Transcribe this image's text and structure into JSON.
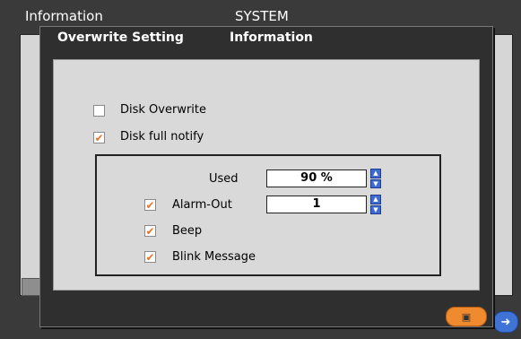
{
  "background_window": {
    "title": "Information",
    "center_title": "SYSTEM",
    "nav_icon": "arrow-right-icon"
  },
  "dialog": {
    "title": "Overwrite Setting",
    "tab": "Information",
    "disk_overwrite": {
      "label": "Disk Overwrite",
      "checked": false
    },
    "disk_full_notify": {
      "label": "Disk full notify",
      "checked": true
    },
    "used": {
      "label": "Used",
      "value": "90 %"
    },
    "alarm_out": {
      "label": "Alarm-Out",
      "value": "1",
      "checked": true
    },
    "beep": {
      "label": "Beep",
      "checked": true
    },
    "blink_message": {
      "label": "Blink Message",
      "checked": true
    },
    "save_icon": "save-icon",
    "accent_color": "#f08a2e"
  }
}
